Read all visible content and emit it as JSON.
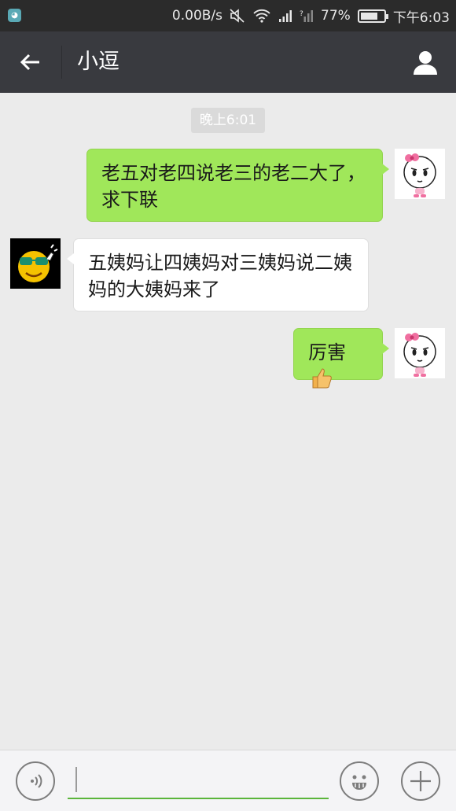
{
  "status_bar": {
    "net_speed": "0.00B/s",
    "battery_percent": "77%",
    "battery_level": 0.77,
    "time": "下午6:03"
  },
  "header": {
    "title": "小逗"
  },
  "chat": {
    "timestamp": "晚上6:01",
    "messages": [
      {
        "direction": "out",
        "text": "老五对老四说老三的老二大了，求下联"
      },
      {
        "direction": "in",
        "text": "五姨妈让四姨妈对三姨妈说二姨妈的大姨妈来了"
      },
      {
        "direction": "out",
        "text": "厉害",
        "emoji": "thumbs-up-icon"
      }
    ]
  },
  "input": {
    "value": "",
    "placeholder": ""
  }
}
